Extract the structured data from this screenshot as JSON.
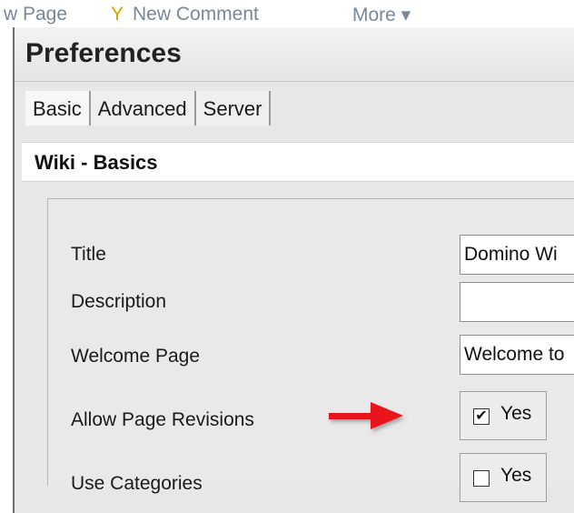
{
  "background": {
    "toolbar": {
      "item_1": "w Page",
      "item_2": "New Comment",
      "item_3": "More ▾"
    }
  },
  "dialog": {
    "title": "Preferences",
    "tabs": [
      {
        "label": "Basic"
      },
      {
        "label": "Advanced"
      },
      {
        "label": "Server"
      }
    ],
    "section_title": "Wiki - Basics",
    "fields": {
      "title": {
        "label": "Title",
        "value": "Domino Wi"
      },
      "description": {
        "label": "Description",
        "value": ""
      },
      "welcome_page": {
        "label": "Welcome Page",
        "value": "Welcome to"
      },
      "allow_revisions": {
        "label": "Allow Page Revisions",
        "option_label": "Yes",
        "checked": true,
        "check_mark": "✔"
      },
      "use_categories": {
        "label": "Use Categories",
        "option_label": "Yes",
        "checked": false,
        "check_mark": ""
      }
    }
  },
  "colors": {
    "arrow": "#e8141c",
    "dialog_bg": "#e7e7e7"
  }
}
